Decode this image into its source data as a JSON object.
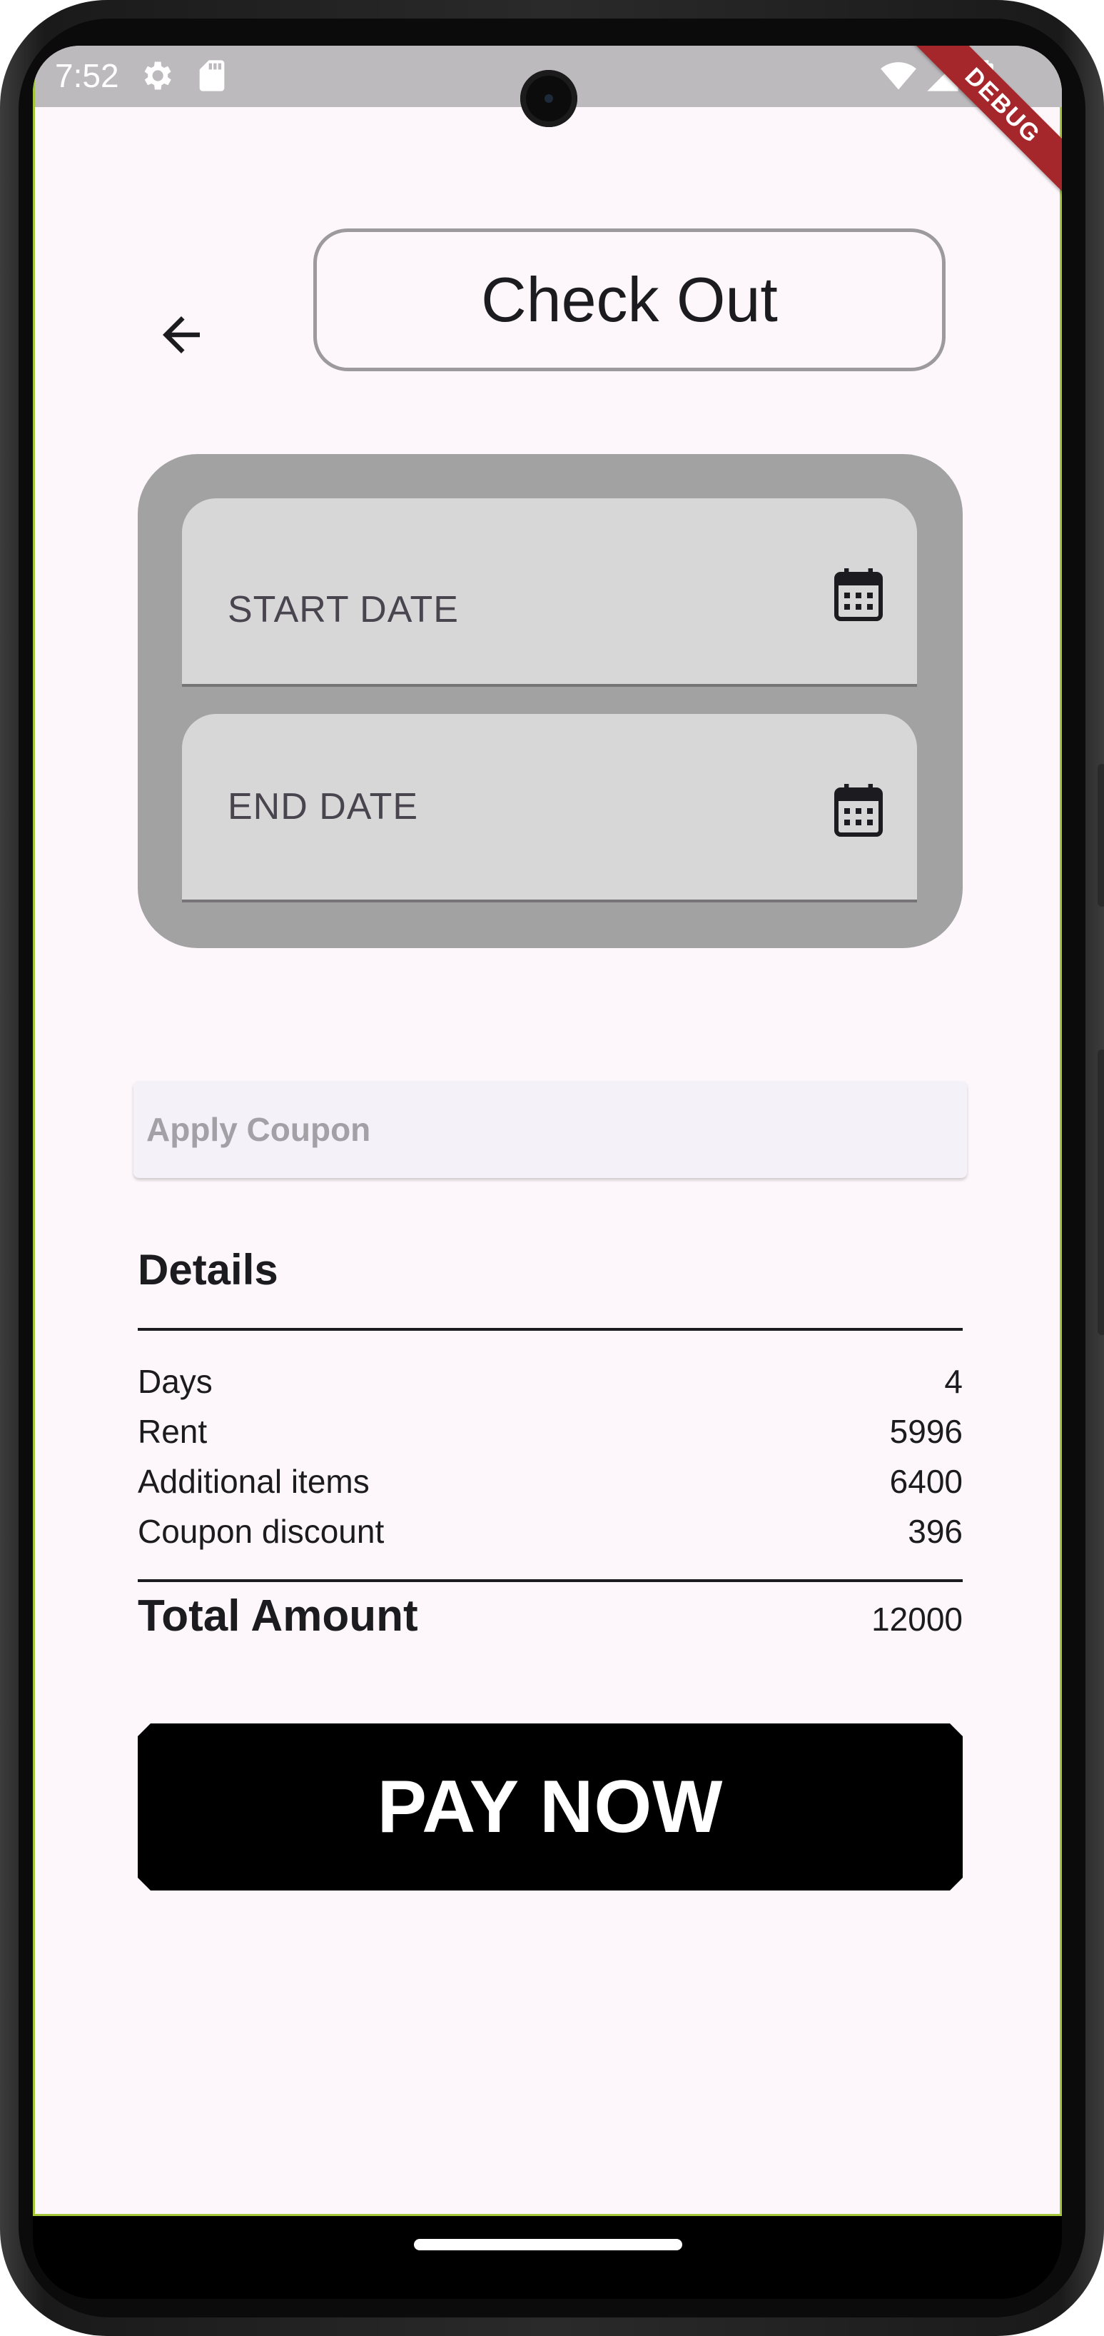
{
  "status_bar": {
    "time": "7:52",
    "icons": [
      "gear-icon",
      "sd-card-icon",
      "wifi-icon",
      "signal-icon",
      "battery-icon"
    ]
  },
  "debug_banner": "DEBUG",
  "header": {
    "back_icon": "arrow-left-icon",
    "title": "Check Out"
  },
  "dates": {
    "start_label": "START DATE",
    "end_label": "END DATE",
    "icon": "calendar-icon"
  },
  "coupon": {
    "placeholder": "Apply Coupon"
  },
  "details": {
    "title": "Details",
    "rows": [
      {
        "label": "Days",
        "value": "4"
      },
      {
        "label": "Rent",
        "value": "5996"
      },
      {
        "label": "Additional items",
        "value": "6400"
      },
      {
        "label": "Coupon discount",
        "value": "396"
      }
    ],
    "total_label": "Total Amount",
    "total_value": "12000"
  },
  "pay_button": {
    "label": "PAY NOW"
  },
  "colors": {
    "background": "#fdf7fb",
    "date_panel": "#a3a2a3",
    "date_field": "#d8d7d8",
    "pay_button": "#000000",
    "debug_ribbon": "#a6272b",
    "frame_outline": "#a4c639"
  }
}
